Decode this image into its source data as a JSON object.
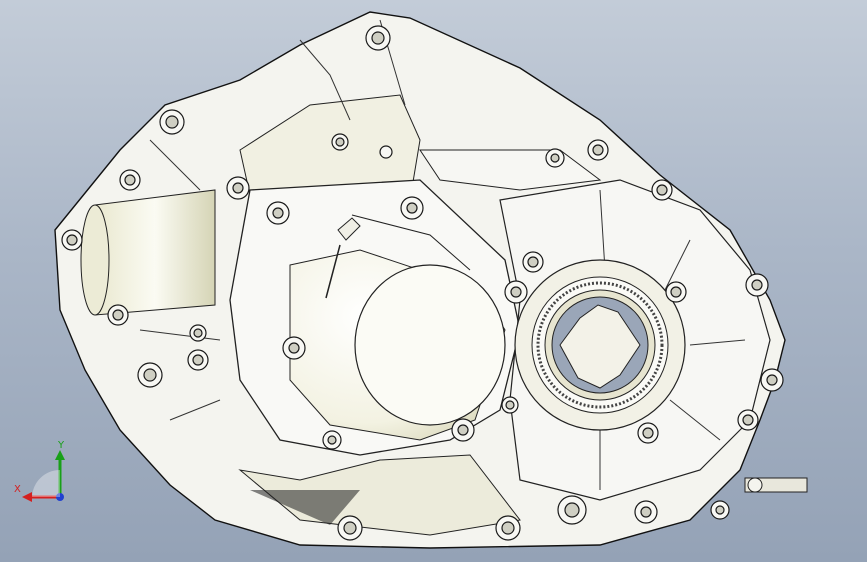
{
  "view": {
    "model": "gearbox-housing",
    "display_style": "shaded-with-edges"
  },
  "triad": {
    "x_label": "X",
    "y_label": "Y",
    "x_color": "#d42020",
    "y_color": "#18a018",
    "z_color": "#2040d0"
  },
  "colors": {
    "background_top": "#c3ccd8",
    "background_bottom": "#94a2b6",
    "part_fill": "#f6f6f2",
    "part_shade": "#d9d8c4",
    "edge": "#1a1a1a"
  },
  "icons": [
    "coordinate-triad-icon"
  ]
}
